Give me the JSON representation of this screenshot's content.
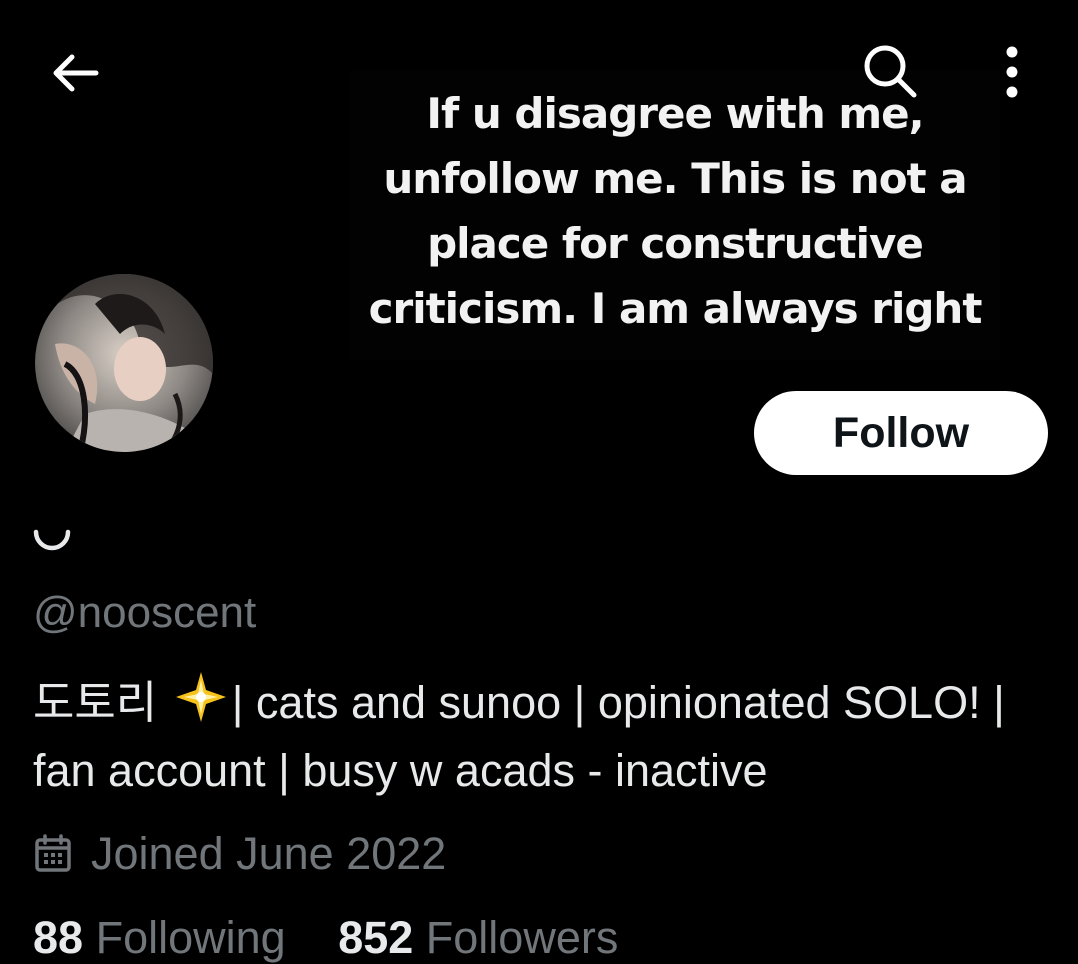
{
  "header": {
    "back_icon": "back-arrow-icon",
    "search_icon": "search-icon",
    "more_icon": "more-vertical-icon"
  },
  "banner": {
    "text": "If u disagree with me, unfollow me. This is not a place for constructive criticism. I am always right"
  },
  "profile": {
    "follow_label": "Follow",
    "handle": "@nooscent",
    "bio_prefix": "도토리",
    "bio_emoji": "sparkle-star-icon",
    "bio_text": "| cats and sunoo | opinionated SOLO! | fan account | busy w acads - inactive",
    "joined": "Joined June 2022",
    "following_count": "88",
    "following_label": "Following",
    "followers_count": "852",
    "followers_label": "Followers"
  },
  "colors": {
    "background": "#000000",
    "primary_text": "#e7e9ea",
    "secondary_text": "#71767b",
    "follow_button_bg": "#ffffff"
  }
}
